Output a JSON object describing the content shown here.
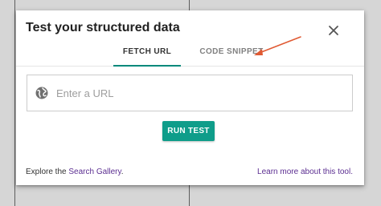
{
  "dialog": {
    "title": "Test your structured data",
    "close_icon": "close-icon"
  },
  "tabs": [
    {
      "label": "FETCH URL",
      "active": true
    },
    {
      "label": "CODE SNIPPET",
      "active": false
    }
  ],
  "url_field": {
    "icon": "globe-icon",
    "placeholder": "Enter a URL",
    "value": ""
  },
  "run_button": {
    "label": "RUN TEST"
  },
  "footer": {
    "explore_prefix": "Explore the ",
    "gallery_link": "Search Gallery",
    "explore_suffix": ".",
    "learn_more_link": "Learn more about this tool."
  },
  "colors": {
    "accent": "#0f9d8a",
    "link": "#5b2e91",
    "annotation_arrow": "#e05a33"
  }
}
